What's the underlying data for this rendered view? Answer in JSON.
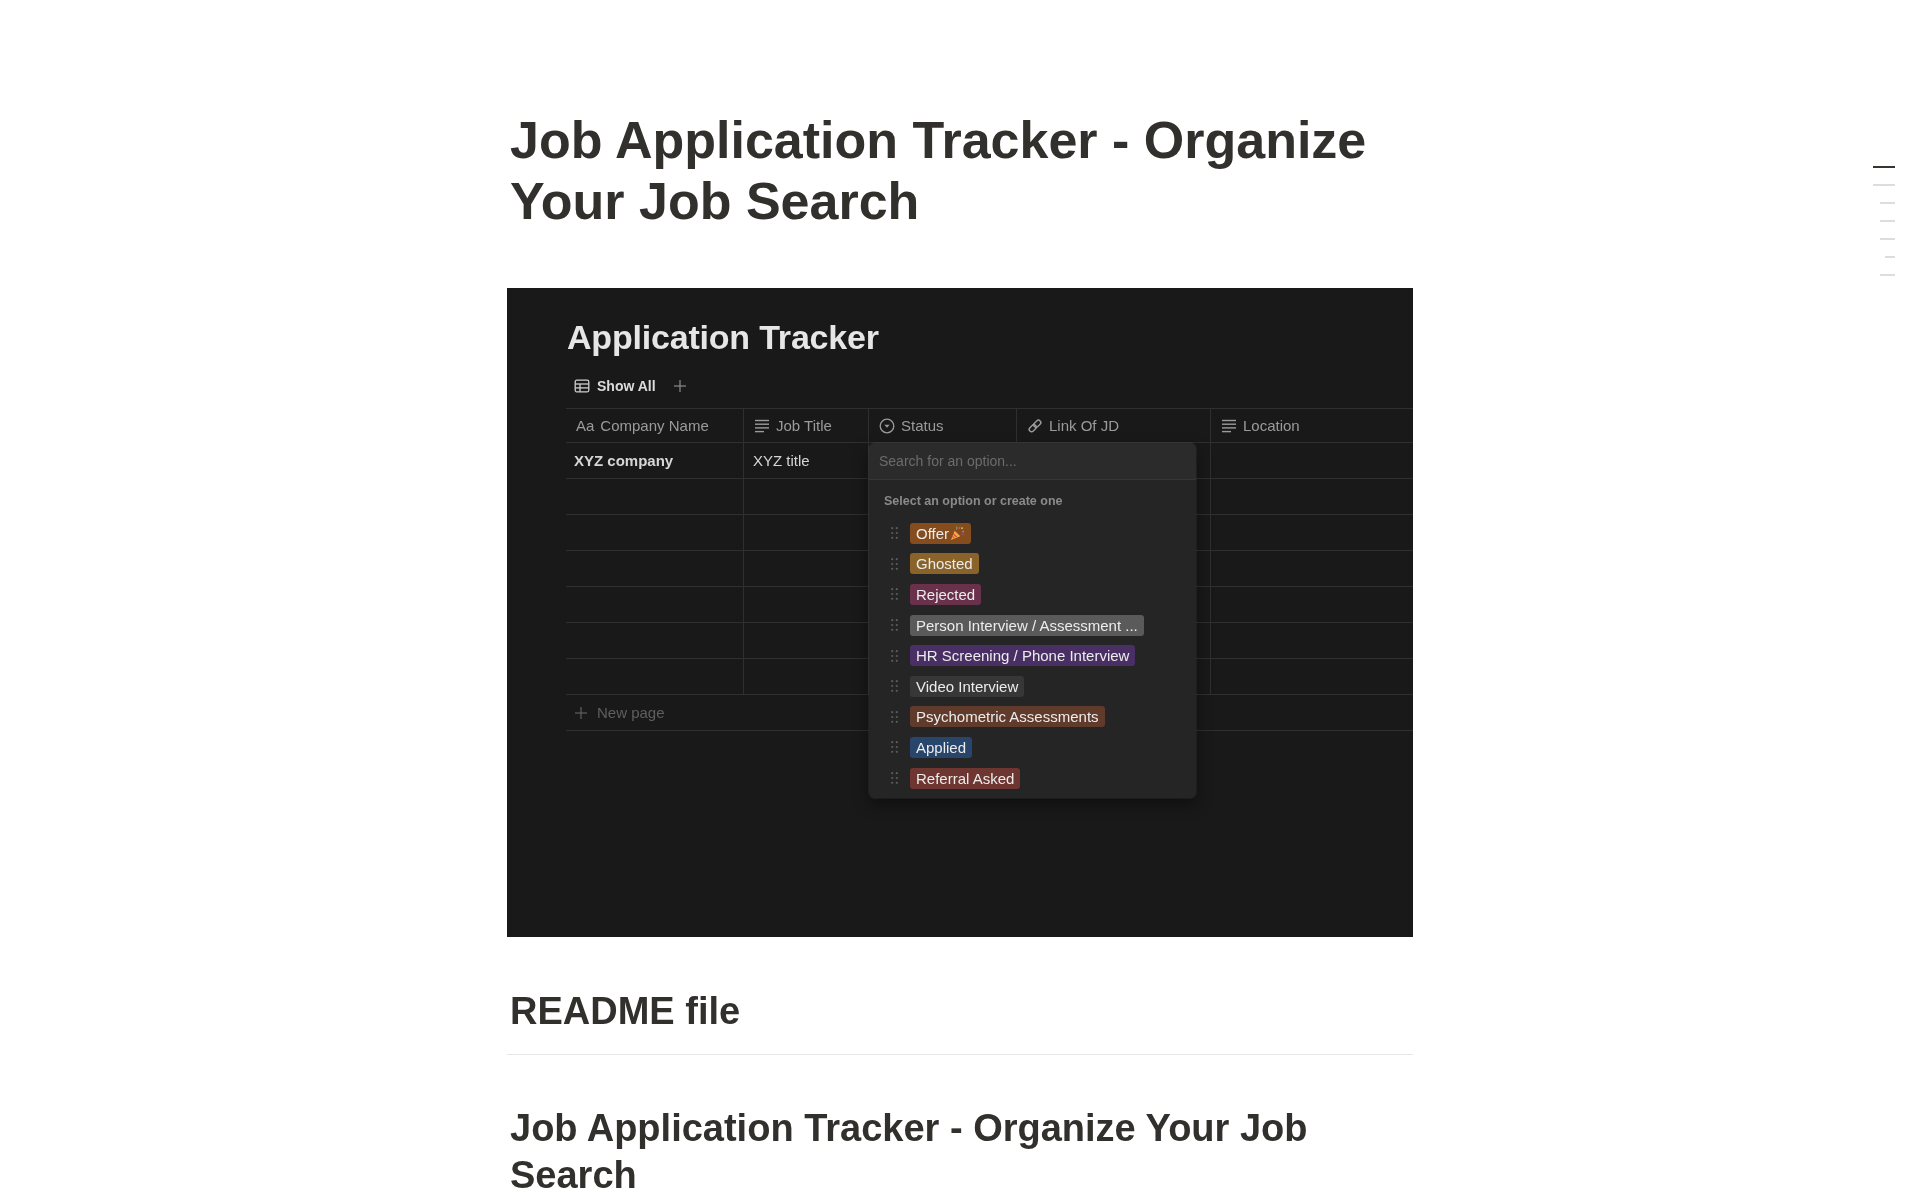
{
  "page": {
    "title": "Job Application Tracker - Organize Your Job Search"
  },
  "embedded_screenshot": {
    "title": "Application Tracker",
    "view_tab": {
      "label": "Show All"
    },
    "table": {
      "columns": [
        {
          "kind": "title",
          "type_label": "Aa",
          "label": "Company Name"
        },
        {
          "kind": "text",
          "label": "Job Title"
        },
        {
          "kind": "status",
          "label": "Status"
        },
        {
          "kind": "url",
          "label": "Link Of JD"
        },
        {
          "kind": "text",
          "label": "Location"
        }
      ],
      "rows": [
        {
          "cells": [
            "XYZ company",
            "XYZ title"
          ]
        }
      ],
      "new_row_label": "New page"
    },
    "status_menu": {
      "search": {
        "placeholder": "Search for an option..."
      },
      "hint": "Select an option or create one",
      "options": [
        {
          "label": "Offer",
          "color": "#854c1d",
          "has_emoji": true
        },
        {
          "label": "Ghosted",
          "color": "#89632a",
          "has_emoji": false
        },
        {
          "label": "Rejected",
          "color": "#69314c",
          "has_emoji": false
        },
        {
          "label": "Person Interview / Assessment ...",
          "color": "#5a5a5a",
          "has_emoji": false
        },
        {
          "label": "HR Screening / Phone Interview",
          "color": "#492f64",
          "has_emoji": false
        },
        {
          "label": "Video Interview",
          "color": "#373737",
          "has_emoji": false
        },
        {
          "label": "Psychometric Assessments",
          "color": "#603b2c",
          "has_emoji": false
        },
        {
          "label": "Applied",
          "color": "#28456c",
          "has_emoji": false
        },
        {
          "label": "Referral Asked",
          "color": "#6e3630",
          "has_emoji": false
        }
      ]
    }
  },
  "readme": {
    "title": "README file"
  },
  "section": {
    "title": "Job Application Tracker - Organize Your Job Search"
  },
  "page_outline": [
    {
      "selected": true
    },
    {
      "selected": false,
      "children": [
        {
          "selected": false
        },
        {
          "selected": false
        },
        {
          "selected": false,
          "children": [
            {
              "selected": false
            }
          ]
        },
        {
          "selected": false
        }
      ]
    }
  ]
}
